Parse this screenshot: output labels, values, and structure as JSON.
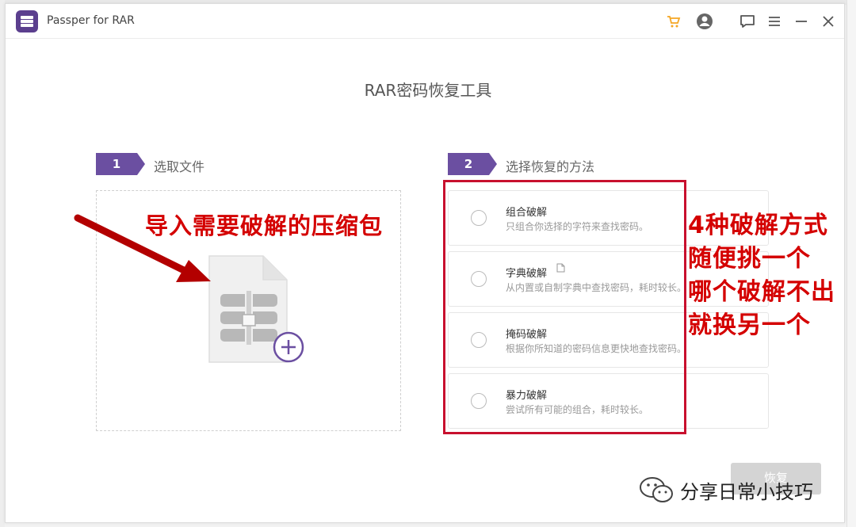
{
  "app": {
    "title": "Passper for RAR",
    "brand_color": "#5b3f8e",
    "accent_color": "#f5a623"
  },
  "titlebar_icons": [
    "cart-icon",
    "account-icon",
    "feedback-icon",
    "menu-icon",
    "minimize-icon",
    "close-icon"
  ],
  "page": {
    "title": "RAR密码恢复工具"
  },
  "steps": [
    {
      "number": "1",
      "label": "选取文件"
    },
    {
      "number": "2",
      "label": "选择恢复的方法"
    }
  ],
  "methods": [
    {
      "title": "组合破解",
      "desc": "只组合你选择的字符来查找密码。"
    },
    {
      "title": "字典破解",
      "desc": "从内置或自制字典中查找密码，耗时较长。"
    },
    {
      "title": "掩码破解",
      "desc": "根据你所知道的密码信息更快地查找密码。"
    },
    {
      "title": "暴力破解",
      "desc": "尝试所有可能的组合，耗时较长。"
    }
  ],
  "recover_button": {
    "label": "恢复"
  },
  "annotations": {
    "left": "导入需要破解的压缩包",
    "right_lines": [
      "4种破解方式",
      "随便挑一个",
      "哪个破解不出",
      "就换另一个"
    ],
    "color": "#d40000"
  },
  "watermark": {
    "text": "分享日常小技巧"
  }
}
